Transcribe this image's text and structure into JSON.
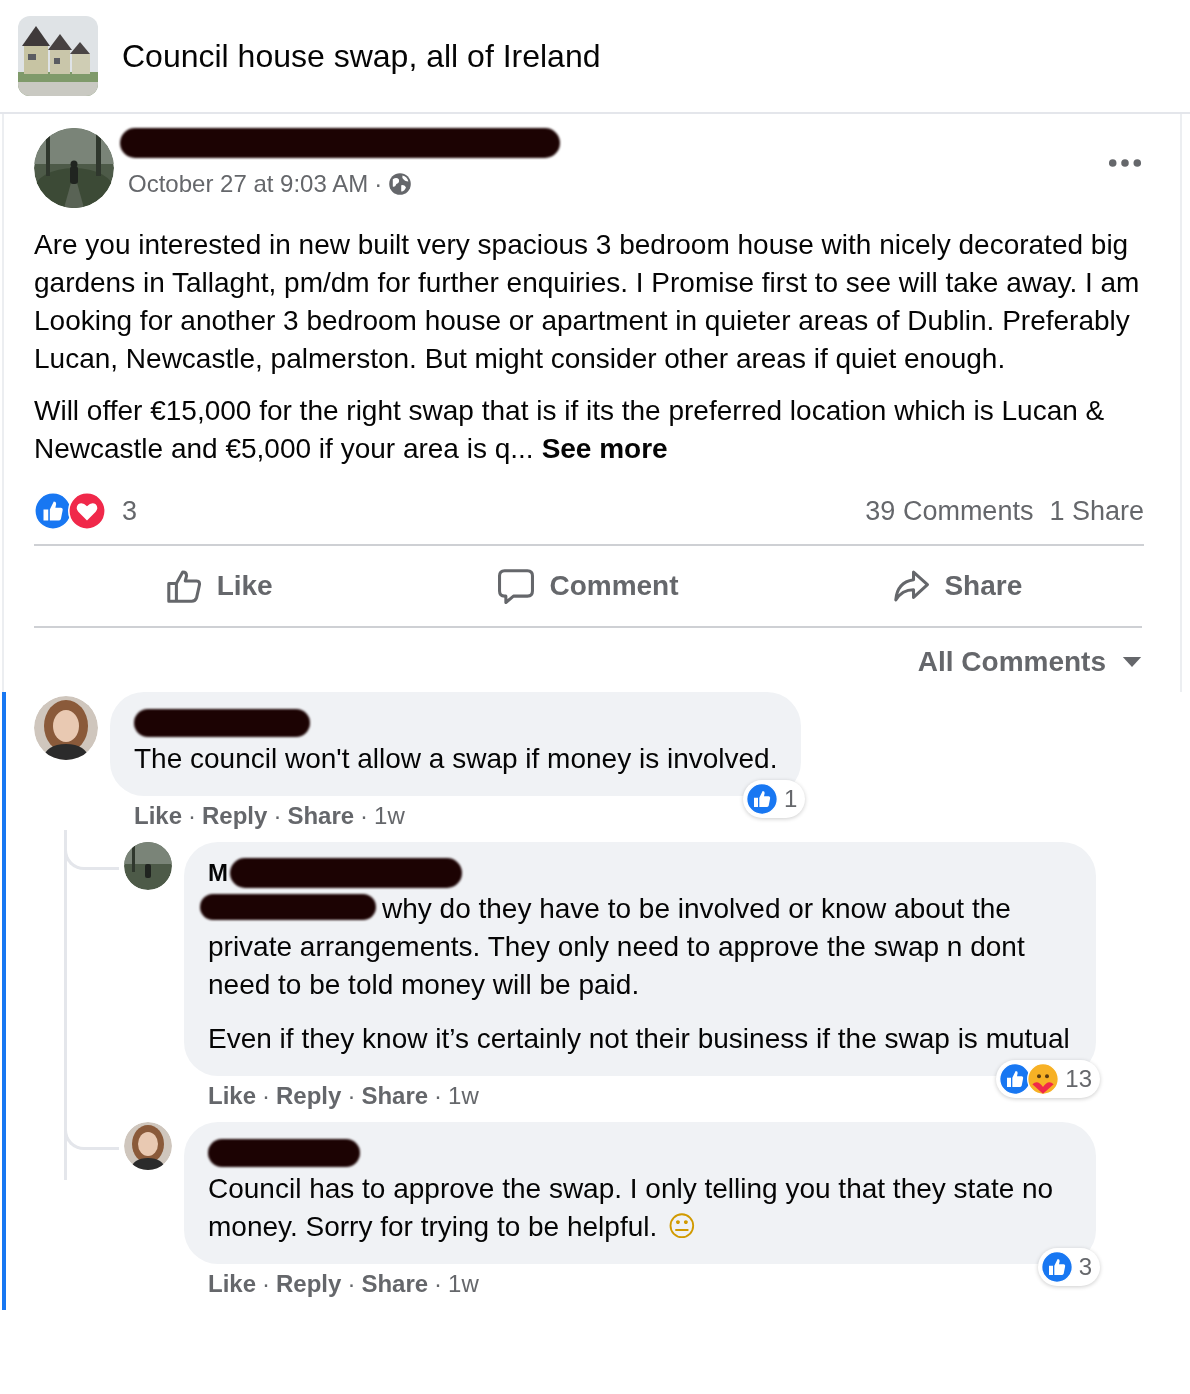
{
  "group": {
    "title": "Council house swap, all of Ireland"
  },
  "post": {
    "author_redacted": true,
    "timestamp": "October 27 at 9:03 AM",
    "separator": "·",
    "paragraphs": [
      "Are you interested in new built very spacious 3 bedroom house with nicely decorated big gardens in Tallaght, pm/dm for further enquiries. I Promise first to see will take away. I am Looking for another 3 bedroom house or apartment in quieter areas of Dublin. Preferably Lucan, Newcastle, palmerston. But might consider other areas if quiet enough.",
      "Will offer €15,000 for the right swap that is if its the preferred location which is Lucan & Newcastle and €5,000 if your area is q..."
    ],
    "see_more": "See more",
    "reactions": [
      {
        "kind": "like"
      },
      {
        "kind": "love"
      }
    ],
    "reaction_count": "3",
    "comment_count": "39 Comments",
    "share_count": "1 Share",
    "actions": [
      {
        "kind": "like",
        "label": "Like"
      },
      {
        "kind": "comment",
        "label": "Comment"
      },
      {
        "kind": "share",
        "label": "Share"
      }
    ]
  },
  "comment_filter": "All Comments",
  "comments": [
    {
      "author_redacted": true,
      "paragraphs": [
        {
          "text": "The council won't allow a swap if money is involved."
        }
      ],
      "reactions": [
        {
          "kind": "like"
        }
      ],
      "reaction_count": "1",
      "links": [
        "Like",
        "Reply",
        "Share"
      ],
      "separator": "·",
      "time": "1w",
      "children": [
        {
          "author_redacted": true,
          "name_fragment": "M",
          "paragraphs": [
            {
              "mention_redacted": true,
              "text": "why do they have to be involved or know about the private arrangements. They only need to approve the swap n dont need to be told money will be paid."
            },
            {
              "text": "Even if they know it’s certainly not their business if the swap is mutual"
            }
          ],
          "reactions": [
            {
              "kind": "like"
            },
            {
              "kind": "care"
            }
          ],
          "reaction_count": "13",
          "links": [
            "Like",
            "Reply",
            "Share"
          ],
          "separator": "·",
          "time": "1w"
        },
        {
          "author_redacted": true,
          "paragraphs": [
            {
              "text": "Council has to approve the swap. I only telling you that they state no money. Sorry for trying to be helpful.",
              "emoji": "😐"
            }
          ],
          "reactions": [
            {
              "kind": "like"
            }
          ],
          "reaction_count": "3",
          "links": [
            "Like",
            "Reply",
            "Share"
          ],
          "separator": "·",
          "time": "1w"
        }
      ]
    }
  ]
}
